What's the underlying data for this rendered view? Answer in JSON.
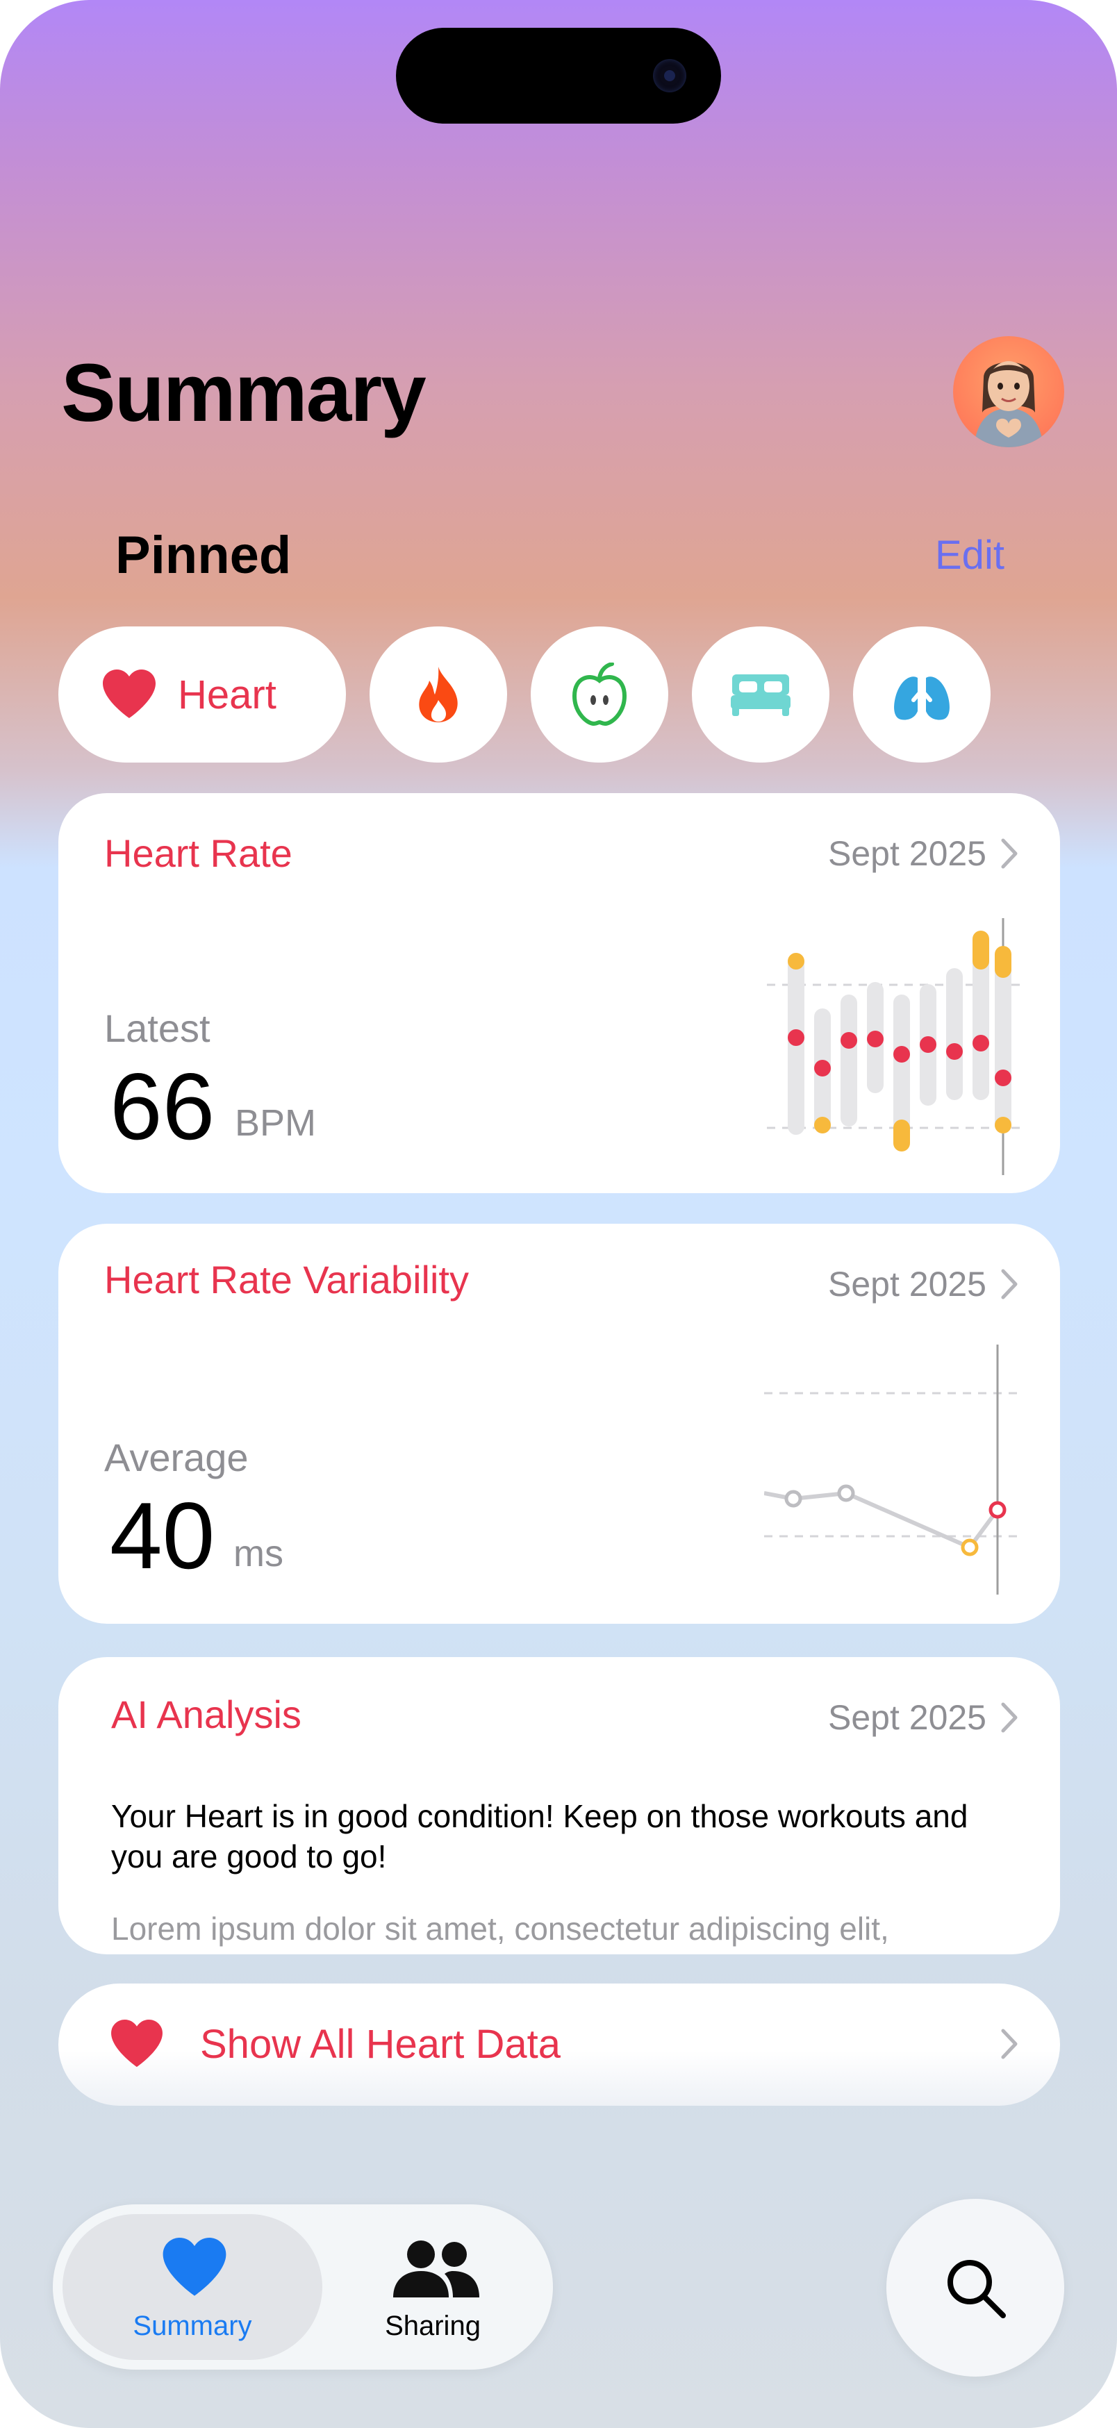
{
  "header": {
    "title": "Summary"
  },
  "pinned": {
    "title": "Pinned",
    "edit_label": "Edit"
  },
  "chips": {
    "heart_label": "Heart",
    "icons": [
      "heart-icon",
      "flame-icon",
      "apple-icon",
      "bed-icon",
      "lungs-icon"
    ]
  },
  "heart_rate": {
    "title": "Heart Rate",
    "date": "Sept 2025",
    "label": "Latest",
    "value": "66",
    "unit": "BPM"
  },
  "hrv": {
    "title": "Heart Rate Variability",
    "date": "Sept 2025",
    "label": "Average",
    "value": "40",
    "unit": "ms"
  },
  "ai": {
    "title": "AI Analysis",
    "date": "Sept 2025",
    "text": "Your Heart is in good condition! Keep on those workouts and you are good to go!",
    "fade_text": "Lorem ipsum dolor sit amet, consectetur adipiscing elit,"
  },
  "show_all": {
    "label": "Show All Heart Data"
  },
  "tabbar": {
    "summary_label": "Summary",
    "sharing_label": "Sharing"
  },
  "colors": {
    "accent_red": "#e8344e",
    "accent_blue": "#1a7bf2",
    "edit_purple": "#6a6ff0",
    "range_gray": "#e6e6e8",
    "highlight_yellow": "#f7b93c"
  }
}
